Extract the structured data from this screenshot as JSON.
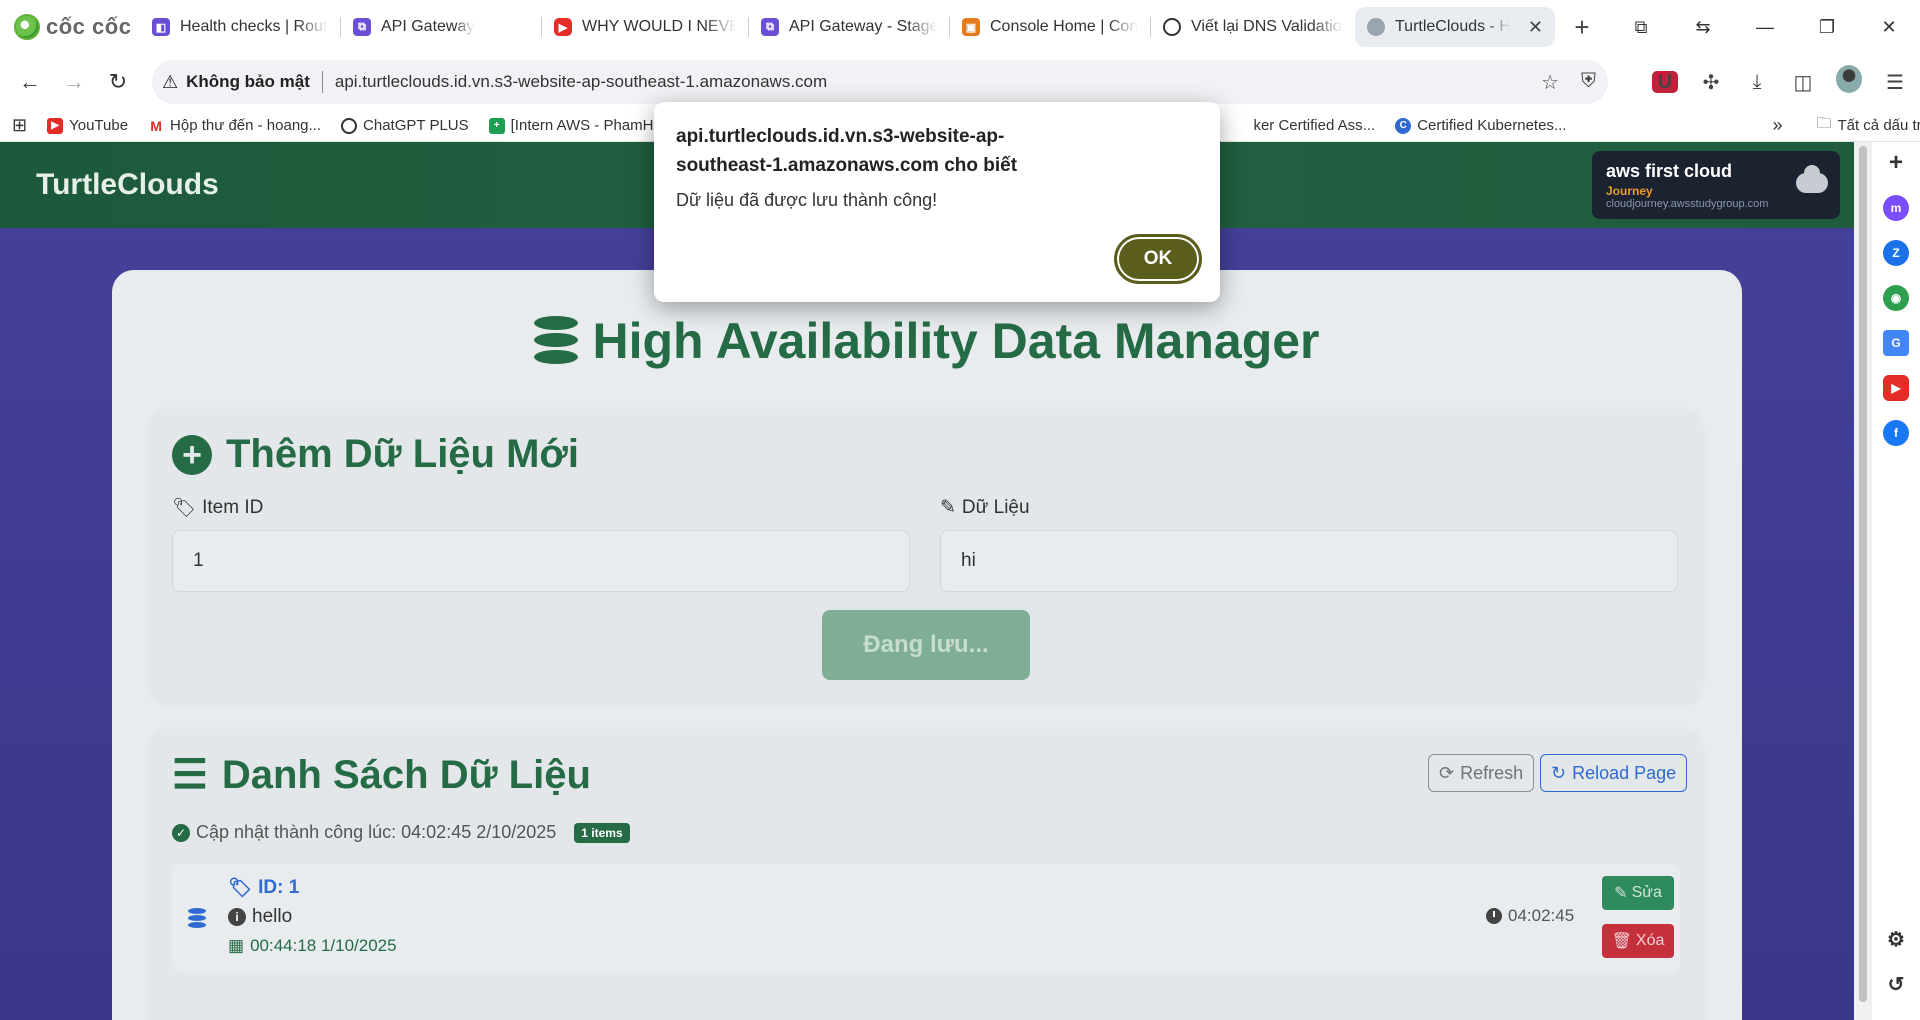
{
  "browser": {
    "brand": "cốc cốc",
    "tabs": [
      {
        "title": "Health checks | Route",
        "icon": "route53-icon",
        "active": false
      },
      {
        "title": "API Gateway",
        "icon": "api-gateway-icon",
        "active": false
      },
      {
        "title": "WHY WOULD I NEVER",
        "icon": "youtube-icon",
        "active": false
      },
      {
        "title": "API Gateway - Stages",
        "icon": "api-gateway-icon",
        "active": false
      },
      {
        "title": "Console Home | Console",
        "icon": "aws-console-icon",
        "active": false
      },
      {
        "title": "Viết lại DNS Validation",
        "icon": "chatgpt-icon",
        "active": false
      },
      {
        "title": "TurtleClouds - High",
        "icon": "globe-icon",
        "active": true
      }
    ],
    "security_label": "Không bảo mật",
    "url": "api.turtleclouds.id.vn.s3-website-ap-southeast-1.amazonaws.com",
    "bookmarks": [
      {
        "label": "YouTube"
      },
      {
        "label": "Hộp thư đến - hoang..."
      },
      {
        "label": "ChatGPT PLUS"
      },
      {
        "label": "[Intern AWS - PhamH"
      },
      {
        "label": "ker Certified Ass..."
      },
      {
        "label": "Certified Kubernetes..."
      }
    ],
    "all_bookmarks": "Tất cả dấu trang"
  },
  "site": {
    "logo": "TurtleClouds",
    "badge": {
      "title": "aws first cloud",
      "sub": "Journey",
      "url": "cloudjourney.awsstudygroup.com"
    },
    "app_title": "High Availability Data Manager",
    "add_section": {
      "title": "Thêm Dữ Liệu Mới",
      "item_id_label": "Item ID",
      "item_id_value": "1",
      "data_label": "Dữ Liệu",
      "data_value": "hi",
      "save_label": "Đang lưu..."
    },
    "list_section": {
      "title": "Danh Sách Dữ Liệu",
      "refresh_label": "Refresh",
      "reload_label": "Reload Page",
      "status": "Cập nhật thành công lúc: 04:02:45 2/10/2025",
      "count_badge": "1 items",
      "items": [
        {
          "id": "ID: 1",
          "data": "hello",
          "created": "00:44:18 1/10/2025",
          "updated": "04:02:45",
          "edit_label": "Sửa",
          "delete_label": "Xóa"
        }
      ]
    }
  },
  "alert": {
    "title": "api.turtleclouds.id.vn.s3-website-ap-southeast-1.amazonaws.com cho biết",
    "message": "Dữ liệu đã được lưu thành công!",
    "ok_label": "OK"
  },
  "colors": {
    "brand_green": "#256b45",
    "link_blue": "#2e6ad1",
    "danger_red": "#c4303c",
    "ok_button": "#5b5d1d"
  }
}
